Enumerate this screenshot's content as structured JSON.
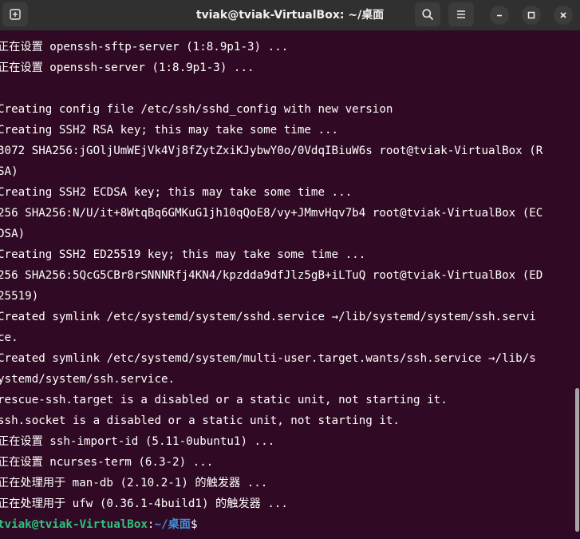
{
  "window": {
    "title": "tviak@tviak-VirtualBox: ~/桌面"
  },
  "toolbar": {
    "new_tab_icon": "new-tab-icon",
    "search_icon": "search-icon",
    "menu_icon": "hamburger-menu-icon",
    "minimize_icon": "minimize-icon",
    "maximize_icon": "maximize-icon",
    "close_icon": "close-icon"
  },
  "colors": {
    "terminal_bg": "#300a24",
    "titlebar_bg": "#303030",
    "prompt_user": "#2ec27e",
    "prompt_path": "#3f8fd8",
    "text": "#ffffff"
  },
  "terminal": {
    "lines": [
      "正在设置 openssh-sftp-server (1:8.9p1-3) ...",
      "正在设置 openssh-server (1:8.9p1-3) ...",
      "",
      "Creating config file /etc/ssh/sshd_config with new version",
      "Creating SSH2 RSA key; this may take some time ...",
      "3072 SHA256:jGOljUmWEjVk4Vj8fZytZxiKJybwY0o/0VdqIBiuW6s root@tviak-VirtualBox (R",
      "SA)",
      "Creating SSH2 ECDSA key; this may take some time ...",
      "256 SHA256:N/U/it+8WtqBq6GMKuG1jh10qQoE8/vy+JMmvHqv7b4 root@tviak-VirtualBox (EC",
      "DSA)",
      "Creating SSH2 ED25519 key; this may take some time ...",
      "256 SHA256:5QcG5CBr8rSNNNRfj4KN4/kpzdda9dfJlz5gB+iLTuQ root@tviak-VirtualBox (ED",
      "25519)",
      "Created symlink /etc/systemd/system/sshd.service →/lib/systemd/system/ssh.servi",
      "ce.",
      "Created symlink /etc/systemd/system/multi-user.target.wants/ssh.service →/lib/s",
      "ystemd/system/ssh.service.",
      "rescue-ssh.target is a disabled or a static unit, not starting it.",
      "ssh.socket is a disabled or a static unit, not starting it.",
      "正在设置 ssh-import-id (5.11-0ubuntu1) ...",
      "正在设置 ncurses-term (6.3-2) ...",
      "正在处理用于 man-db (2.10.2-1) 的触发器 ...",
      "正在处理用于 ufw (0.36.1-4build1) 的触发器 ..."
    ],
    "prompt": {
      "user_host": "tviak@tviak-VirtualBox",
      "separator": ":",
      "path": "~/桌面",
      "symbol": "$"
    }
  }
}
